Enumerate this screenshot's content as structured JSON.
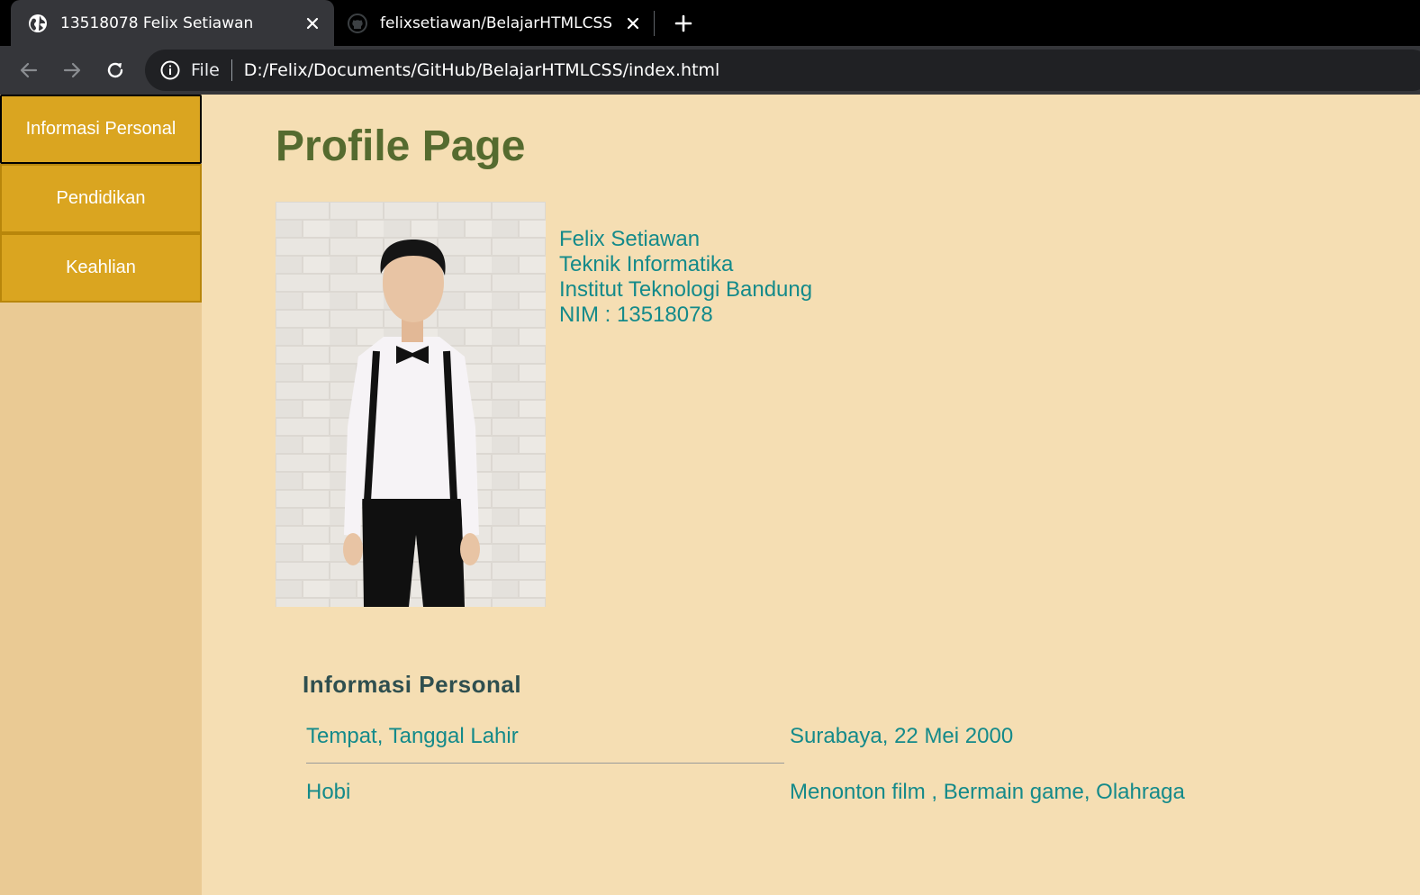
{
  "browser": {
    "tabs": [
      {
        "title": "13518078 Felix Setiawan",
        "favicon": "globe-icon",
        "active": true
      },
      {
        "title": "felixsetiawan/BelajarHTMLCSS",
        "favicon": "github-icon",
        "active": false
      }
    ],
    "omnibox": {
      "scheme_label": "File",
      "url": "D:/Felix/Documents/GitHub/BelajarHTMLCSS/index.html"
    }
  },
  "sidebar": {
    "items": [
      {
        "label": "Informasi Personal",
        "active": true
      },
      {
        "label": "Pendidikan",
        "active": false
      },
      {
        "label": "Keahlian",
        "active": false
      }
    ]
  },
  "profile": {
    "page_title": "Profile Page",
    "name": "Felix Setiawan",
    "major": "Teknik Informatika",
    "institution": "Institut Teknologi Bandung",
    "nim": "NIM : 13518078"
  },
  "personal_info": {
    "heading": "Informasi Personal",
    "rows": [
      {
        "label": "Tempat, Tanggal Lahir",
        "value": "Surabaya, 22 Mei 2000"
      },
      {
        "label": "Hobi",
        "value": "Menonton film , Bermain game, Olahraga"
      }
    ]
  },
  "colors": {
    "page_bg": "#f5deb3",
    "sidebar_bg": "#eaca94",
    "menu_bg": "#daa520",
    "title": "#556b2f",
    "text": "#148a8a",
    "heading": "#2f4f4f"
  }
}
